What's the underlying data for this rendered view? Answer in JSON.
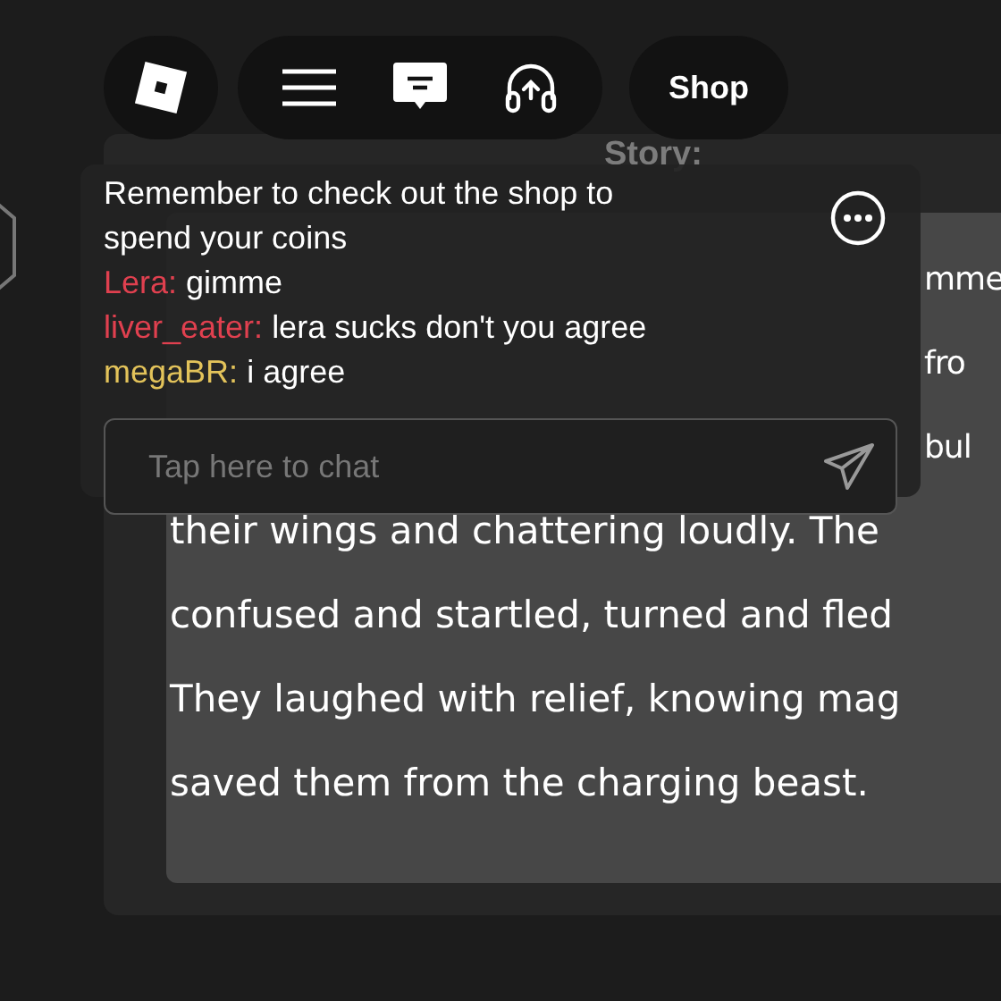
{
  "top_bar": {
    "shop_button": {
      "label": "Shop"
    }
  },
  "story": {
    "heading": "Story:",
    "fragments": [
      "mme",
      "fro",
      "bul"
    ],
    "lines": [
      "their wings and chattering loudly. The",
      "confused and startled, turned and fled",
      "They laughed with relief, knowing mag",
      "saved them from the charging beast."
    ]
  },
  "chat": {
    "messages": [
      {
        "kind": "system",
        "text": "Remember to check out the shop to spend your coins"
      },
      {
        "kind": "user",
        "author": "Lera:",
        "color": "#e0404f",
        "text": "gimme"
      },
      {
        "kind": "user",
        "author": "liver_eater:",
        "color": "#e0404f",
        "text": "lera sucks don't you agree"
      },
      {
        "kind": "user",
        "author": "megaBR:",
        "color": "#e3c35a",
        "text": "i agree"
      }
    ],
    "input": {
      "placeholder": "Tap here to chat"
    }
  }
}
